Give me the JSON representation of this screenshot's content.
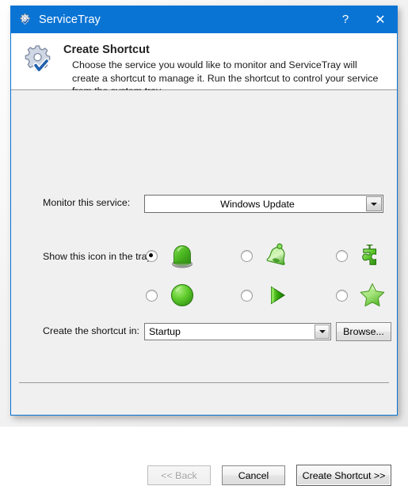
{
  "window": {
    "title": "ServiceTray",
    "title_icon": "gear-check-icon",
    "help_label": "?",
    "close_label": "✕"
  },
  "banner": {
    "icon": "gear-check-icon",
    "title": "Create Shortcut",
    "description": "Choose the service you would like to monitor and ServiceTray will create a shortcut to manage it. Run the shortcut to control your service from the system tray."
  },
  "form": {
    "service": {
      "label": "Monitor this service:",
      "value": "Windows Update"
    },
    "icon_picker": {
      "label": "Show this icon in the tray:",
      "selected_index": 0,
      "options": [
        {
          "name": "led-light-icon"
        },
        {
          "name": "bell-icon"
        },
        {
          "name": "puzzle-piece-icon"
        },
        {
          "name": "circle-icon"
        },
        {
          "name": "play-triangle-icon"
        },
        {
          "name": "star-icon"
        }
      ]
    },
    "location": {
      "label": "Create the shortcut in:",
      "value": "Startup",
      "browse_label": "Browse..."
    }
  },
  "footer": {
    "back_label": "<< Back",
    "cancel_label": "Cancel",
    "create_label": "Create Shortcut >>"
  },
  "colors": {
    "titlebar": "#0a74d4",
    "frame_border": "#0a74d4",
    "body": "#f0f0f0",
    "banner": "#ffffff",
    "icon_green": "#4fbf26"
  }
}
